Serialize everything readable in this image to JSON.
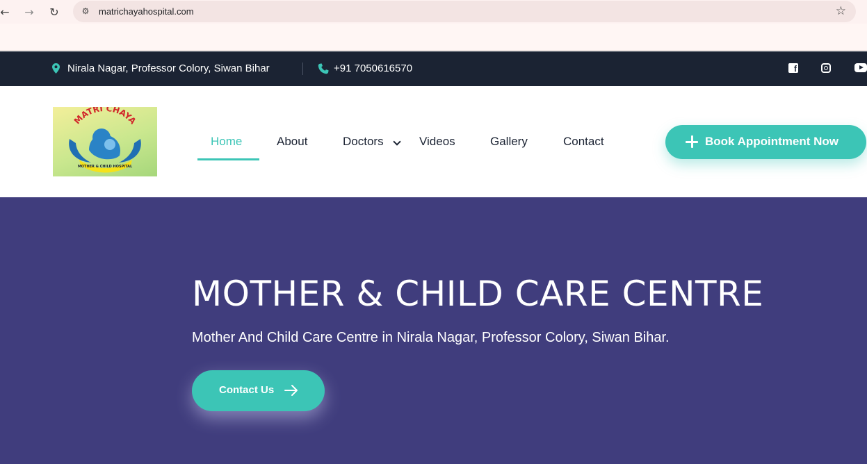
{
  "browser": {
    "url": "matrichayahospital.com",
    "back_icon": "back-arrow-icon",
    "forward_icon": "forward-arrow-icon",
    "reload_icon": "reload-icon",
    "star_icon": "star-icon"
  },
  "topbar": {
    "address": "Nirala Nagar, Professor Colory, Siwan Bihar",
    "phone": "+91 7050616570",
    "social": [
      "facebook-icon",
      "instagram-icon",
      "youtube-icon"
    ]
  },
  "header": {
    "logo_text": "MATRI CHAYA",
    "logo_subtext": "MOTHER & CHILD HOSPITAL",
    "nav": [
      {
        "label": "Home",
        "active": true
      },
      {
        "label": "About"
      },
      {
        "label": "Doctors"
      },
      {
        "label": "Videos"
      },
      {
        "label": "Gallery"
      },
      {
        "label": "Contact"
      }
    ],
    "cta_label": "Book Appointment Now"
  },
  "hero": {
    "title": "MOTHER & CHILD CARE CENTRE",
    "subtitle": "Mother And Child Care Centre in Nirala Nagar, Professor Colory, Siwan Bihar.",
    "button_label": "Contact Us"
  },
  "colors": {
    "accent": "#3cc5b6",
    "topbar_bg": "#1b2333",
    "hero_bg": "#403d7d"
  }
}
